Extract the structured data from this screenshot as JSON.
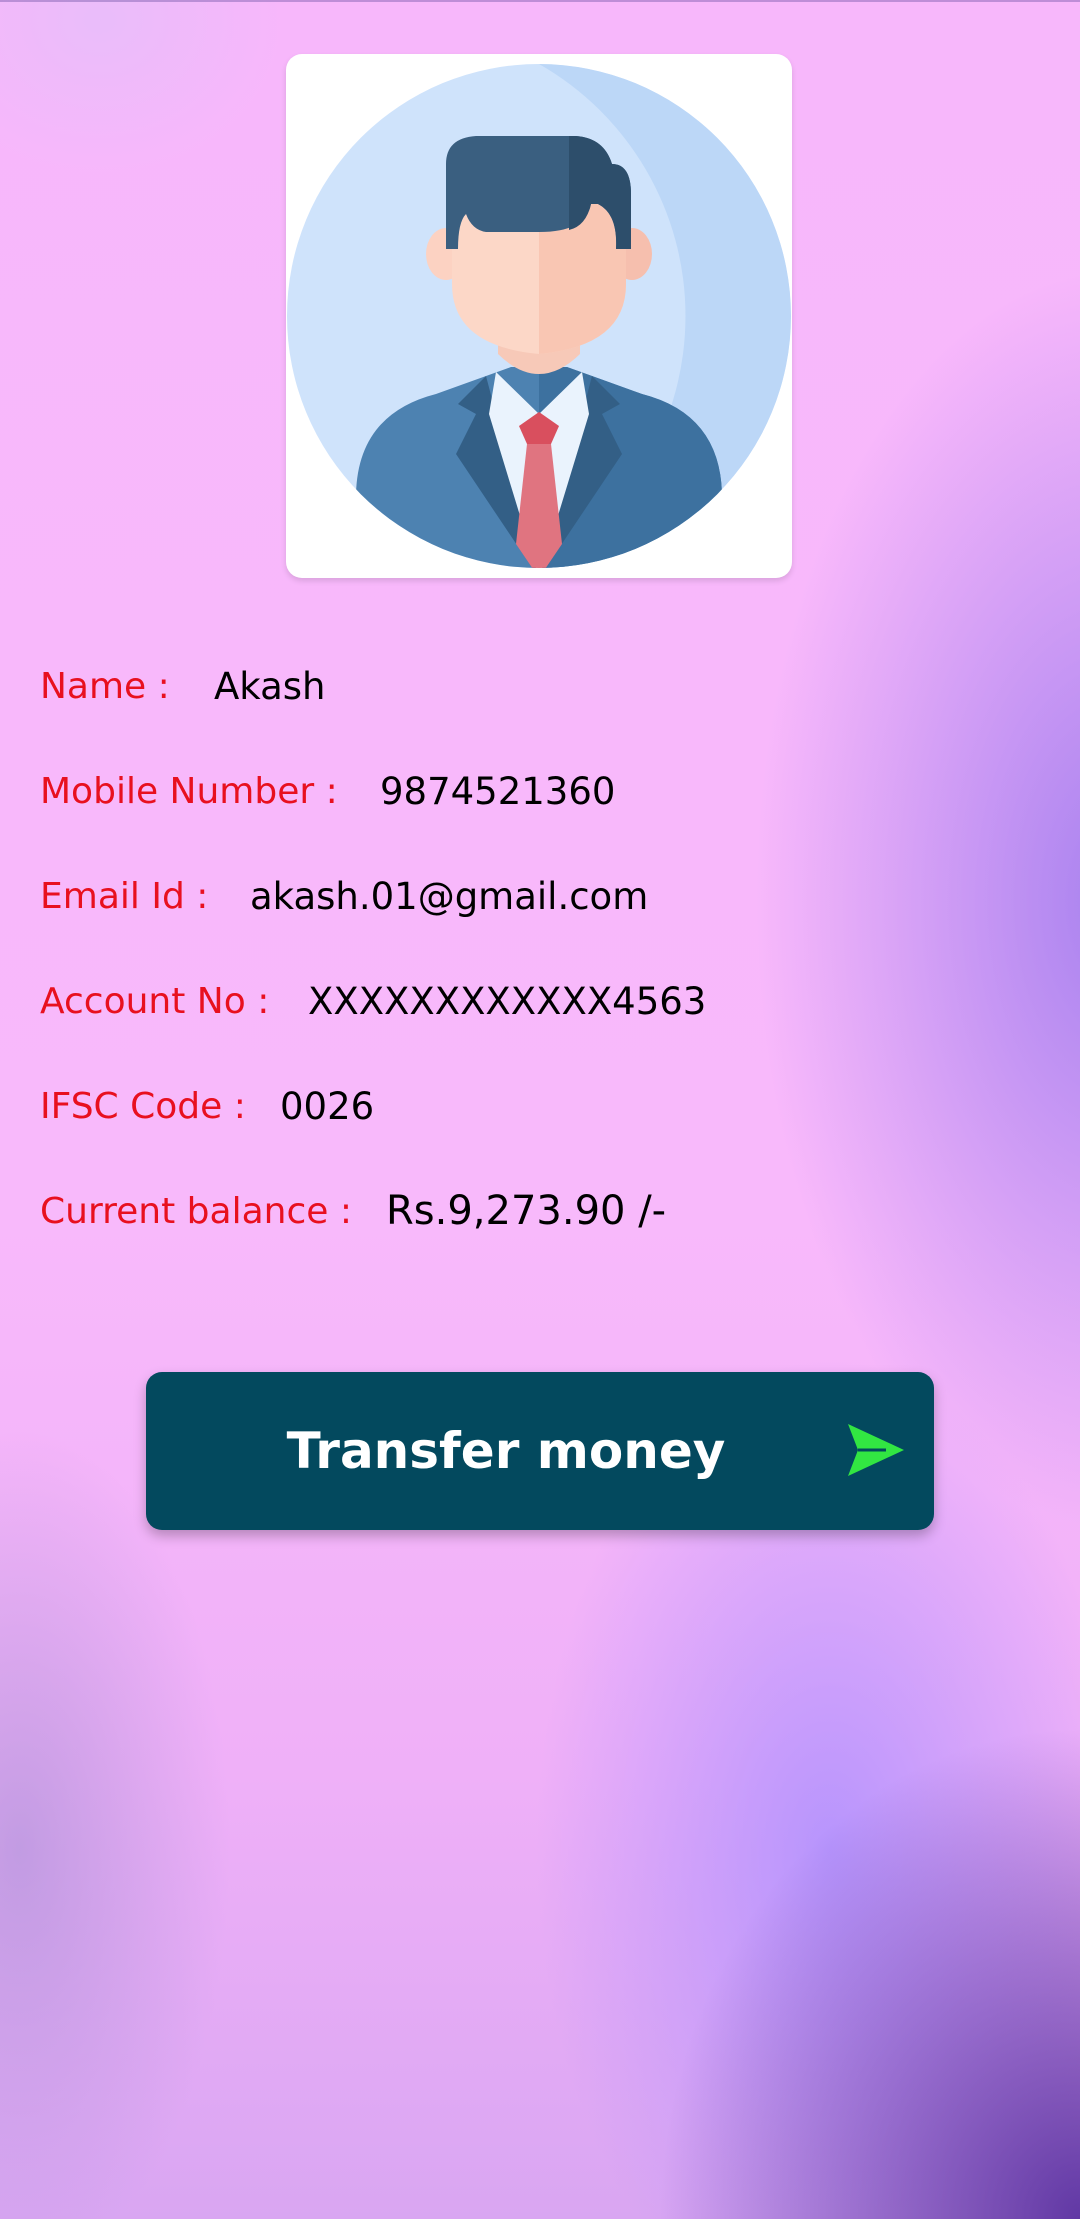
{
  "profile": {
    "avatar_icon": "businessman-avatar-icon",
    "fields": [
      {
        "label": "Name :",
        "value": "Akash"
      },
      {
        "label": "Mobile Number :",
        "value": "9874521360"
      },
      {
        "label": "Email Id :",
        "value": "akash.01@gmail.com"
      },
      {
        "label": "Account No :",
        "value": "XXXXXXXXXXXX4563"
      },
      {
        "label": "IFSC Code :",
        "value": "0026"
      },
      {
        "label": "Current balance :",
        "value": "Rs.9,273.90 /-"
      }
    ]
  },
  "actions": {
    "transfer_label": "Transfer money",
    "transfer_icon": "send-arrow-icon"
  },
  "colors": {
    "label": "#e8101f",
    "button_bg": "#03495e",
    "button_text": "#ffffff",
    "send_icon": "#32e642"
  }
}
